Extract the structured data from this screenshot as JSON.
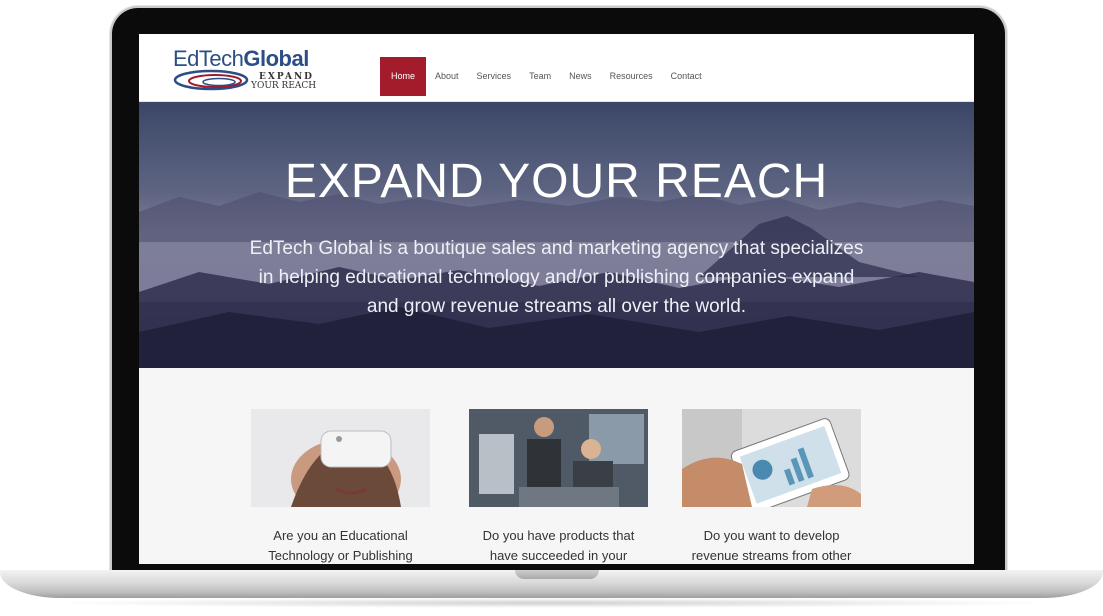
{
  "logo": {
    "brand_light": "EdTech",
    "brand_bold": "Global",
    "tagline_1": "EXPAND",
    "tagline_2": "YOUR REACH"
  },
  "nav": {
    "items": [
      "Home",
      "About",
      "Services",
      "Team",
      "News",
      "Resources",
      "Contact"
    ],
    "active": "Home"
  },
  "hero": {
    "title": "EXPAND YOUR REACH",
    "text": "EdTech Global is a boutique sales and marketing agency that specializes in helping educational technology and/or publishing companies expand and grow revenue streams all over the world."
  },
  "cards": [
    {
      "image": "person-wearing-vr-headset",
      "text": "Are you an Educational Technology or Publishing"
    },
    {
      "image": "engineers-working-on-hardware",
      "text": "Do you have products that have succeeded in your"
    },
    {
      "image": "hands-on-tablet-with-charts",
      "text": "Do you want to develop revenue streams from other"
    }
  ],
  "colors": {
    "accent": "#a31c2c",
    "brand_blue": "#2b4e86"
  }
}
